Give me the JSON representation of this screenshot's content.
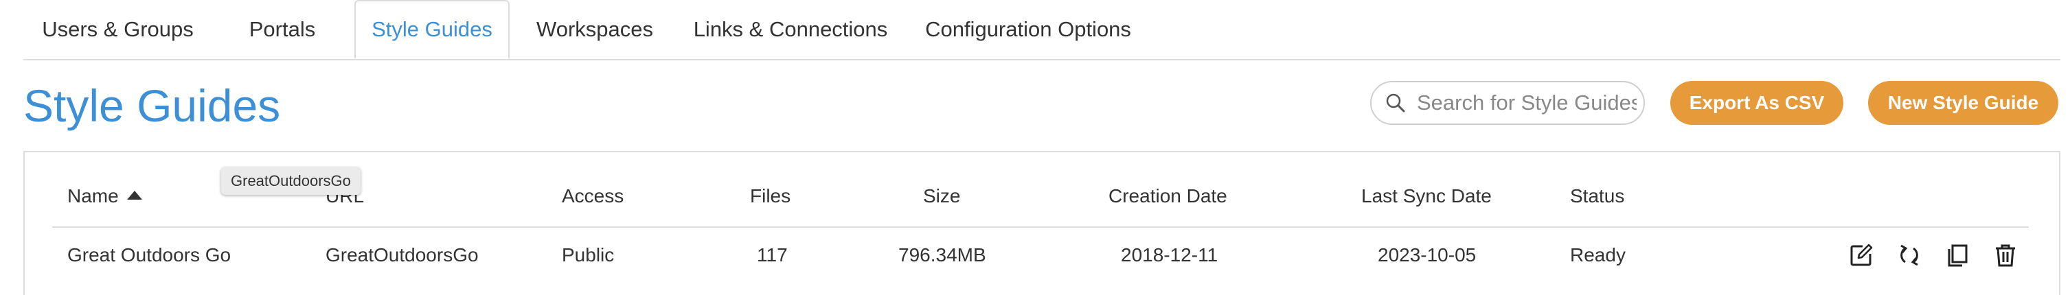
{
  "tabs": [
    {
      "label": "Users & Groups"
    },
    {
      "label": "Portals"
    },
    {
      "label": "Style Guides"
    },
    {
      "label": "Workspaces"
    },
    {
      "label": "Links & Connections"
    },
    {
      "label": "Configuration Options"
    }
  ],
  "active_tab": "Style Guides",
  "header": {
    "title": "Style Guides",
    "search_placeholder": "Search for Style Guides",
    "export_label": "Export As CSV",
    "new_label": "New Style Guide"
  },
  "table": {
    "columns": [
      "Name",
      "URL",
      "Access",
      "Files",
      "Size",
      "Creation Date",
      "Last Sync Date",
      "Status"
    ],
    "sort_column": "Name",
    "sort_direction": "ascending",
    "rows": [
      {
        "name": "Great Outdoors Go",
        "url": "GreatOutdoorsGo",
        "access": "Public",
        "files": "117",
        "size": "796.34MB",
        "creation_date": "2018-12-11",
        "last_sync_date": "2023-10-05",
        "status": "Ready"
      }
    ]
  },
  "tooltip": "GreatOutdoorsGo",
  "row_actions": [
    "edit-icon",
    "sync-icon",
    "copy-icon",
    "delete-icon"
  ],
  "colors": {
    "accent": "#3d8fd6",
    "button": "#e69a3a",
    "border": "#dcdcdc"
  }
}
